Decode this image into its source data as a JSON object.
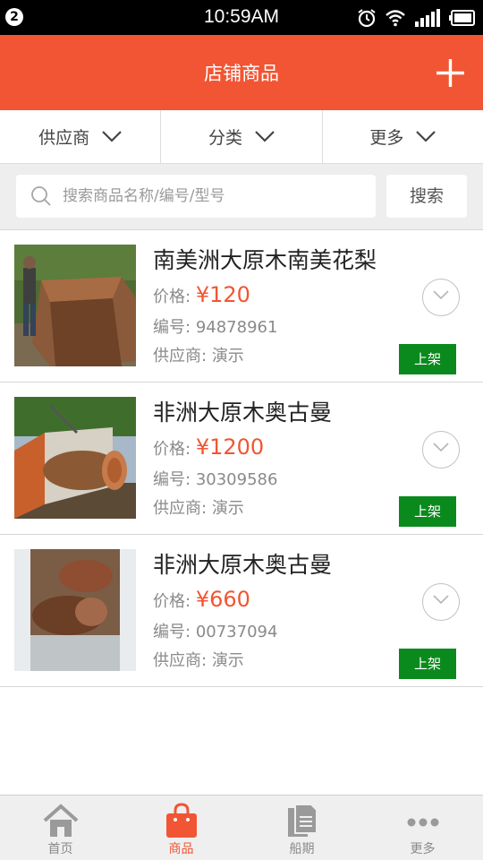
{
  "status_bar": {
    "notification_count": "2",
    "time": "10:59AM",
    "icons": [
      "alarm-icon",
      "wifi-icon",
      "signal-icon",
      "battery-icon"
    ]
  },
  "header": {
    "title": "店铺商品",
    "add_icon": "plus-icon"
  },
  "filters": [
    {
      "label": "供应商",
      "icon": "chevron-down-icon"
    },
    {
      "label": "分类",
      "icon": "chevron-down-icon"
    },
    {
      "label": "更多",
      "icon": "chevron-down-icon"
    }
  ],
  "search": {
    "placeholder": "搜索商品名称/编号/型号",
    "value": "",
    "button_label": "搜索"
  },
  "products": [
    {
      "name": "南美洲大原木南美花梨",
      "price_label": "价格:",
      "price": "¥120",
      "code_label": "编号:",
      "code": "94878961",
      "supplier_label": "供应商:",
      "supplier": "演示",
      "status": "上架"
    },
    {
      "name": "非洲大原木奥古曼",
      "price_label": "价格:",
      "price": "¥1200",
      "code_label": "编号:",
      "code": "30309586",
      "supplier_label": "供应商:",
      "supplier": "演示",
      "status": "上架"
    },
    {
      "name": "非洲大原木奥古曼",
      "price_label": "价格:",
      "price": "¥660",
      "code_label": "编号:",
      "code": "00737094",
      "supplier_label": "供应商:",
      "supplier": "演示",
      "status": "上架"
    }
  ],
  "tabs": [
    {
      "label": "首页",
      "icon": "home-icon",
      "active": false
    },
    {
      "label": "商品",
      "icon": "shopping-bag-icon",
      "active": true
    },
    {
      "label": "船期",
      "icon": "documents-icon",
      "active": false
    },
    {
      "label": "更多",
      "icon": "more-dots-icon",
      "active": false
    }
  ],
  "colors": {
    "brand": "#f15533",
    "status_on_shelf": "#0a8a1c",
    "price": "#f15533"
  }
}
